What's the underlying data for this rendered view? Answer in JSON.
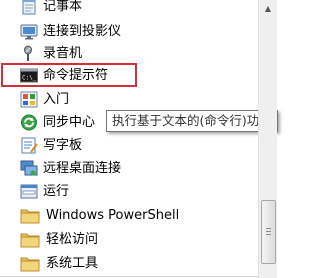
{
  "menu": {
    "items": [
      {
        "label": "记事本",
        "icon": "notepad-icon"
      },
      {
        "label": "连接到投影仪",
        "icon": "projector-icon"
      },
      {
        "label": "录音机",
        "icon": "microphone-icon"
      },
      {
        "label": "命令提示符",
        "icon": "command-prompt-icon"
      },
      {
        "label": "入门",
        "icon": "getting-started-icon"
      },
      {
        "label": "同步中心",
        "icon": "sync-center-icon"
      },
      {
        "label": "写字板",
        "icon": "wordpad-icon"
      },
      {
        "label": "远程桌面连接",
        "icon": "remote-desktop-icon"
      },
      {
        "label": "运行",
        "icon": "run-icon"
      },
      {
        "label": "Windows PowerShell",
        "icon": "folder-icon"
      },
      {
        "label": "轻松访问",
        "icon": "folder-icon"
      },
      {
        "label": "系统工具",
        "icon": "folder-icon"
      }
    ]
  },
  "tooltip": {
    "text": "执行基于文本的(命令行)功能。"
  },
  "colors": {
    "highlight_border": "#d0303a",
    "folder": "#e8c25a",
    "tooltip_border": "#767676"
  }
}
